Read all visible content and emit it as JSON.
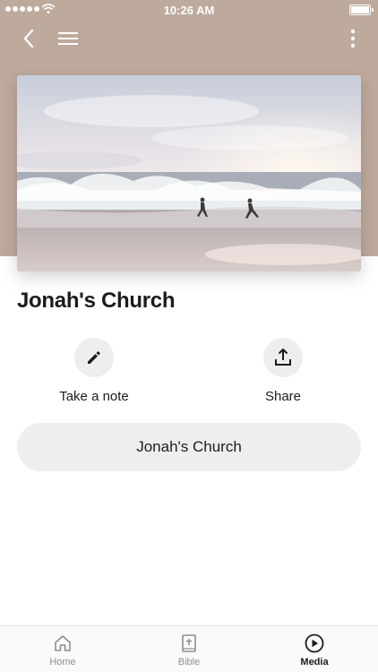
{
  "status_bar": {
    "time": "10:26 AM",
    "signal_bars": 5,
    "battery_level": 1.0
  },
  "nav": {
    "back_icon": "chevron-left-icon",
    "menu_icon": "hamburger-menu-icon",
    "more_icon": "vertical-ellipsis-icon"
  },
  "colors": {
    "hero_background": "#bea99d",
    "button_background": "#eeeef0",
    "text": "#1c1c1e",
    "tab_inactive": "#8e8e93"
  },
  "media": {
    "title": "Jonah's Church",
    "image_icon": "beach-waves-photo"
  },
  "actions": [
    {
      "label": "Take a note",
      "icon": "pencil-icon"
    },
    {
      "label": "Share",
      "icon": "share-upload-icon"
    }
  ],
  "primary_button": {
    "label": "Jonah's Church"
  },
  "tabs": [
    {
      "label": "Home",
      "icon": "home-icon",
      "active": false
    },
    {
      "label": "Bible",
      "icon": "bible-book-icon",
      "active": false
    },
    {
      "label": "Media",
      "icon": "play-circle-icon",
      "active": true
    }
  ]
}
